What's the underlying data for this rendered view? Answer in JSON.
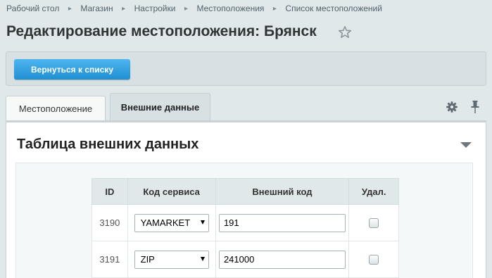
{
  "breadcrumbs": [
    "Рабочий стол",
    "Магазин",
    "Настройки",
    "Местоположения",
    "Список местоположений"
  ],
  "page": {
    "title": "Редактирование местоположения: Брянск"
  },
  "toolbar": {
    "back_label": "Вернуться к списку"
  },
  "tabs": [
    {
      "label": "Местоположение",
      "active": false
    },
    {
      "label": "Внешние данные",
      "active": true
    }
  ],
  "section": {
    "title": "Таблица внешних данных"
  },
  "table": {
    "headers": [
      "ID",
      "Код сервиса",
      "Внешний код",
      "Удал."
    ],
    "rows": [
      {
        "id": "3190",
        "service": "YAMARKET",
        "code": "191",
        "delete_checked": false
      },
      {
        "id": "3191",
        "service": "ZIP",
        "code": "241000",
        "delete_checked": false
      }
    ]
  },
  "icons": {
    "star": "star-outline-icon",
    "settings": "gear-icon",
    "pin": "pin-icon",
    "collapse": "triangle-down-icon",
    "breadcrumb_separator": "chevron-right-icon"
  },
  "colors": {
    "accent": "#2396da",
    "background": "#e0e8ea",
    "panel": "#ffffff"
  }
}
